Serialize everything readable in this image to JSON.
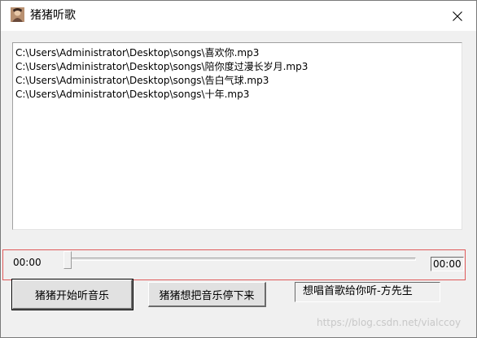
{
  "window": {
    "title": "猪猪听歌",
    "close_glyph": "close-icon"
  },
  "playlist": {
    "items": [
      "C:\\Users\\Administrator\\Desktop\\songs\\喜欢你.mp3",
      "C:\\Users\\Administrator\\Desktop\\songs\\陪你度过漫长岁月.mp3",
      "C:\\Users\\Administrator\\Desktop\\songs\\告白气球.mp3",
      "C:\\Users\\Administrator\\Desktop\\songs\\十年.mp3"
    ]
  },
  "player": {
    "current_time": "00:00",
    "total_time": "00:00",
    "progress": 0,
    "highlight_color": "#e05a5a"
  },
  "controls": {
    "start_label": "猪猪开始听音乐",
    "stop_label": "猪猪想把音乐停下来",
    "status_text": "想唱首歌给你听-方先生"
  },
  "watermark": "https://blog.csdn.net/vialccoy"
}
